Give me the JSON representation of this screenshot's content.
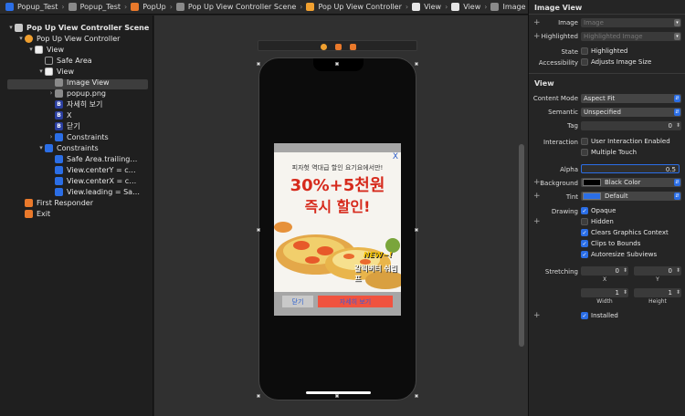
{
  "breadcrumb": [
    {
      "label": "Popup_Test",
      "icon": "xcodeproj-icon",
      "color": "#2b6ee6"
    },
    {
      "label": "Popup_Test",
      "icon": "folder-icon",
      "color": "#8a8a8a"
    },
    {
      "label": "PopUp",
      "icon": "swift-icon",
      "color": "#e9792b"
    },
    {
      "label": "Pop Up View Controller Scene",
      "icon": "storyboard-icon",
      "color": "#8a8a8a"
    },
    {
      "label": "Pop Up View Controller",
      "icon": "view-controller-icon",
      "color": "#f0a030"
    },
    {
      "label": "View",
      "icon": "view-icon",
      "color": "#e6e6e6"
    },
    {
      "label": "View",
      "icon": "view-icon",
      "color": "#e6e6e6"
    },
    {
      "label": "Image View",
      "icon": "image-view-icon",
      "color": "#8a8a8a"
    }
  ],
  "outline": [
    {
      "label": "Pop Up View Controller Scene",
      "depth": 0,
      "tri": "▾",
      "icon": "storyboard-scene-icon",
      "color": "#c9c9c9",
      "bold": true
    },
    {
      "label": "Pop Up View Controller",
      "depth": 1,
      "tri": "▾",
      "icon": "view-controller-icon",
      "color": "#f0a030"
    },
    {
      "label": "View",
      "depth": 2,
      "tri": "▾",
      "icon": "view-icon",
      "color": "#e6e6e6"
    },
    {
      "label": "Safe Area",
      "depth": 3,
      "tri": "",
      "icon": "safe-area-icon",
      "color": "#555"
    },
    {
      "label": "View",
      "depth": 3,
      "tri": "▾",
      "icon": "view-icon",
      "color": "#e6e6e6"
    },
    {
      "label": "Image View",
      "depth": 4,
      "tri": "",
      "icon": "image-view-icon",
      "color": "#8a8a8a"
    },
    {
      "label": "popup.png",
      "depth": 4,
      "tri": "›",
      "icon": "image-file-icon",
      "color": "#8a8a8a"
    },
    {
      "label": "자세히 보기",
      "depth": 4,
      "tri": "",
      "icon": "button-icon",
      "color": "#2b3fa0",
      "glyph": "B"
    },
    {
      "label": "X",
      "depth": 4,
      "tri": "",
      "icon": "button-icon",
      "color": "#2b3fa0",
      "glyph": "B"
    },
    {
      "label": "닫기",
      "depth": 4,
      "tri": "",
      "icon": "button-icon",
      "color": "#2b3fa0",
      "glyph": "B"
    },
    {
      "label": "Constraints",
      "depth": 4,
      "tri": "›",
      "icon": "constraints-icon",
      "color": "#2b6ee6"
    },
    {
      "label": "Constraints",
      "depth": 3,
      "tri": "▾",
      "icon": "constraints-icon",
      "color": "#2b6ee6"
    },
    {
      "label": "Safe Area.trailing…",
      "depth": 4,
      "tri": "",
      "icon": "constraint-icon",
      "color": "#2b6ee6"
    },
    {
      "label": "View.centerY = c…",
      "depth": 4,
      "tri": "",
      "icon": "constraint-icon",
      "color": "#2b6ee6"
    },
    {
      "label": "View.centerX = c…",
      "depth": 4,
      "tri": "",
      "icon": "constraint-icon",
      "color": "#2b6ee6"
    },
    {
      "label": "View.leading = Sa…",
      "depth": 4,
      "tri": "",
      "icon": "constraint-icon",
      "color": "#2b6ee6"
    },
    {
      "label": "First Responder",
      "depth": 1,
      "tri": "",
      "icon": "first-responder-icon",
      "color": "#e9792b"
    },
    {
      "label": "Exit",
      "depth": 1,
      "tri": "",
      "icon": "exit-icon",
      "color": "#e9792b"
    }
  ],
  "popup": {
    "close_x": "X",
    "small_text": "피자헛 역대급 할인 요기요에서만!",
    "big_text_1": "30%+5천원",
    "big_text_2": "즉시 할인!",
    "new_text": "NEW~!",
    "menu_text": "갈릭버터 쉬림프",
    "close_button": "닫기",
    "detail_button": "자세히 보기"
  },
  "inspector": {
    "image_view_section": "Image View",
    "image_label": "Image",
    "image_placeholder": "Image",
    "highlighted_label": "Highlighted",
    "highlighted_placeholder": "Highlighted Image",
    "state_label": "State",
    "state_value": "Highlighted",
    "accessibility_label": "Accessibility",
    "accessibility_value": "Adjusts Image Size",
    "view_section": "View",
    "content_mode_label": "Content Mode",
    "content_mode_value": "Aspect Fit",
    "semantic_label": "Semantic",
    "semantic_value": "Unspecified",
    "tag_label": "Tag",
    "tag_value": "0",
    "interaction_label": "Interaction",
    "user_interaction": "User Interaction Enabled",
    "multiple_touch": "Multiple Touch",
    "alpha_label": "Alpha",
    "alpha_value": "0.5",
    "background_label": "Background",
    "background_value": "Black Color",
    "tint_label": "Tint",
    "tint_value": "Default",
    "drawing_label": "Drawing",
    "opaque": "Opaque",
    "hidden": "Hidden",
    "clears_graphics": "Clears Graphics Context",
    "clips_bounds": "Clips to Bounds",
    "autoresize": "Autoresize Subviews",
    "stretching_label": "Stretching",
    "stretch_x": "0",
    "stretch_y": "0",
    "stretch_width": "1",
    "stretch_height": "1",
    "x_label": "X",
    "y_label": "Y",
    "width_label": "Width",
    "height_label": "Height",
    "installed": "Installed"
  },
  "colors": {
    "accent": "#2b6ee6",
    "ad_red": "#d62a1c",
    "detail_button": "#f0533f",
    "tint_swatch": "#2b6ee6",
    "background_swatch": "#000000"
  }
}
